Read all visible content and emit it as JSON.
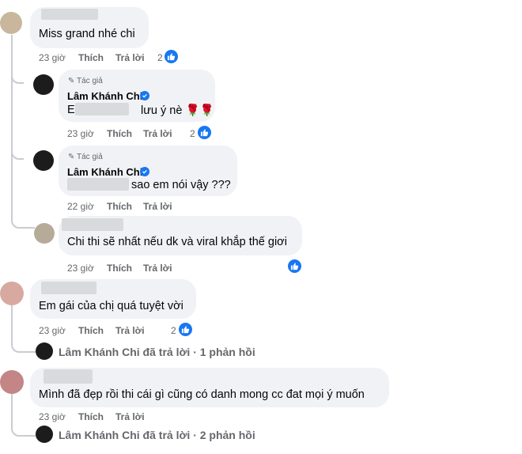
{
  "comments": [
    {
      "text": "Miss grand nhé chi",
      "time": "23 giờ",
      "like": "Thích",
      "reply": "Trả lời",
      "reactions": "2"
    },
    {
      "author_tag": "Tác giả",
      "author": "Lâm Khánh Chi",
      "prefix": "E",
      "text": "lưu ý nè 🌹🌹",
      "time": "23 giờ",
      "like": "Thích",
      "reply": "Trả lời",
      "reactions": "2"
    },
    {
      "author_tag": "Tác giả",
      "author": "Lâm Khánh Chi",
      "text": "sao em nói vậy ???",
      "time": "22 giờ",
      "like": "Thích",
      "reply": "Trả lời"
    },
    {
      "text": "Chi thi sẽ nhất nếu dk và viral khắp thế giơi",
      "time": "23 giờ",
      "like": "Thích",
      "reply": "Trả lời"
    },
    {
      "text": "Em gái của chị quá tuyệt vời",
      "time": "23 giờ",
      "like": "Thích",
      "reply": "Trả lời",
      "reactions": "2",
      "replies_summary": "Lâm Khánh Chi đã trả lời · 1 phản hồi"
    },
    {
      "text": "Mình đã đẹp rồi thi cái gì cũng có danh mong cc đat mọi ý muốn",
      "time": "23 giờ",
      "like": "Thích",
      "reply": "Trả lời",
      "replies_summary": "Lâm Khánh Chi đã trả lời · 2 phản hồi"
    }
  ],
  "colors": {
    "bubble": "#f0f2f5",
    "meta": "#65676b",
    "like_blue": "#1877f2"
  },
  "icons": {
    "verified": "verified-badge-icon",
    "like": "thumbs-up-icon",
    "author": "pencil-icon"
  }
}
